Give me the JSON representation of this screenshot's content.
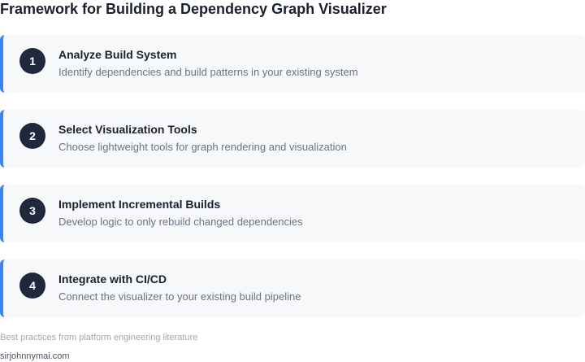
{
  "title": "Framework for Building a Dependency Graph Visualizer",
  "colors": {
    "accent": "#3b82f6",
    "badge": "#1e293b",
    "card_background": "#f7f8fa"
  },
  "steps": [
    {
      "number": "1",
      "title": "Analyze Build System",
      "description": "Identify dependencies and build patterns in your existing system"
    },
    {
      "number": "2",
      "title": "Select Visualization Tools",
      "description": "Choose lightweight tools for graph rendering and visualization"
    },
    {
      "number": "3",
      "title": "Implement Incremental Builds",
      "description": "Develop logic to only rebuild changed dependencies"
    },
    {
      "number": "4",
      "title": "Integrate with CI/CD",
      "description": "Connect the visualizer to your existing build pipeline"
    }
  ],
  "footnote": "Best practices from platform engineering literature",
  "credit": "sirjohnnymai.com"
}
